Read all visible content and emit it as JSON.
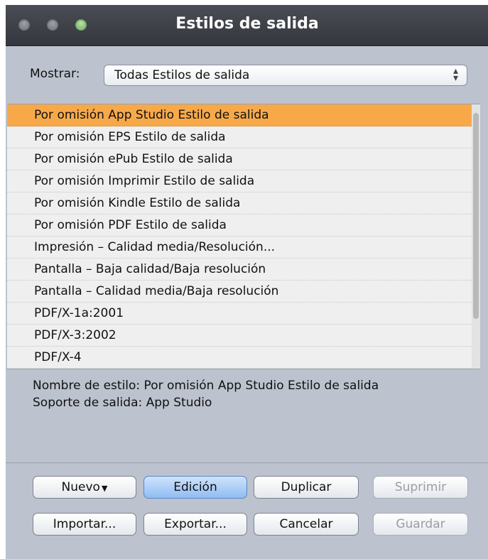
{
  "window": {
    "title": "Estilos de salida"
  },
  "filter": {
    "label": "Mostrar:",
    "selected": "Todas Estilos de salida",
    "arrows": "⬍"
  },
  "styles": [
    "Por omisión App Studio Estilo de salida",
    "Por omisión EPS Estilo de salida",
    "Por omisión ePub Estilo de salida",
    "Por omisión Imprimir Estilo de salida",
    "Por omisión Kindle Estilo de salida",
    "Por omisión PDF Estilo de salida",
    "Impresión – Calidad media/Resolución...",
    "Pantalla – Baja calidad/Baja resolución",
    "Pantalla – Calidad media/Baja resolución",
    "PDF/X-1a:2001",
    "PDF/X-3:2002",
    "PDF/X-4"
  ],
  "selected_index": 0,
  "details": {
    "name_line": "Nombre de estilo: Por omisión App Studio Estilo de salida",
    "output_line": "Soporte de salida: App Studio"
  },
  "buttons": {
    "new": "Nuevo",
    "edit": "Edición",
    "duplicate": "Duplicar",
    "delete": "Suprimir",
    "import": "Importar...",
    "export": "Exportar...",
    "cancel": "Cancelar",
    "save": "Guardar"
  },
  "colors": {
    "selection": "#f7a94a",
    "window_bg": "#bcc3cf",
    "default_button": "#8fbdf2"
  }
}
